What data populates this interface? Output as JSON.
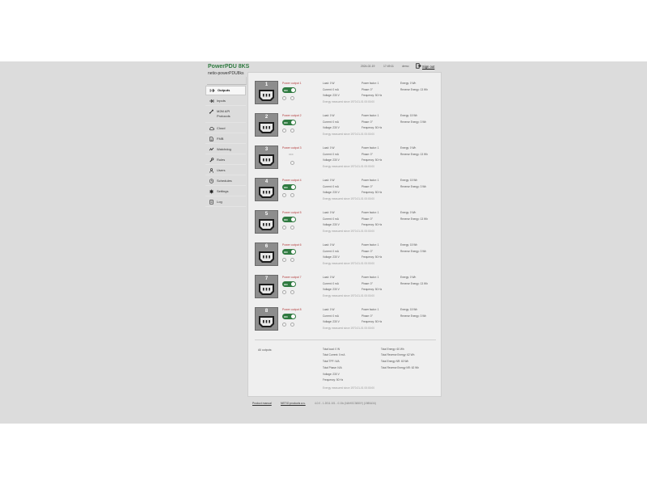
{
  "header": {
    "title": "PowerPDU 8KS",
    "device": "netio-powerPDU8ks",
    "date": "2024-02-19",
    "time": "17:49:11",
    "user": "demo",
    "sign_out": "Sign out"
  },
  "sidebar": {
    "items": [
      {
        "label": "Outputs",
        "icon": "power-out-icon",
        "active": true
      },
      {
        "label": "Inputs",
        "icon": "power-in-icon"
      },
      {
        "label": "M2M API Protocols",
        "label_line1": "M2M API",
        "label_line2": "Protocols",
        "icon": "link-icon"
      },
      {
        "label": "Cloud",
        "icon": "cloud-icon"
      },
      {
        "label": "FMB",
        "icon": "document-icon"
      },
      {
        "label": "Watchdog",
        "icon": "pulse-icon"
      },
      {
        "label": "Rules",
        "icon": "wrench-icon"
      },
      {
        "label": "Users",
        "icon": "user-icon"
      },
      {
        "label": "Schedules",
        "icon": "clock-icon"
      },
      {
        "label": "Settings",
        "icon": "gear-icon"
      },
      {
        "label": "Log",
        "icon": "log-icon"
      }
    ]
  },
  "outputs": [
    {
      "number": "1",
      "name": "Power output 1",
      "state": "ON",
      "load": "Load: 0 W",
      "current": "Current: 0 mA",
      "voltage": "Voltage: 230 V",
      "power_factor": "Power factor: 1",
      "phase": "Phase: 0°",
      "frequency": "Frequency: 50 Hz",
      "energy": "Energy: 0 Wh",
      "reverse_energy": "Reverse Energy: 13 Wh",
      "since": "Energy measured since 1970-01-01 00:00:00"
    },
    {
      "number": "2",
      "name": "Power output 2",
      "state": "ON",
      "load": "Load: 0 W",
      "current": "Current: 0 mA",
      "voltage": "Voltage: 230 V",
      "power_factor": "Power factor: 1",
      "phase": "Phase: 0°",
      "frequency": "Frequency: 50 Hz",
      "energy": "Energy: 15 Wh",
      "reverse_energy": "Reverse Energy: 3 Wh",
      "since": "Energy measured since 1970-01-01 00:00:00"
    },
    {
      "number": "3",
      "name": "Power output 3",
      "state": "OFF",
      "load": "Load: 0 W",
      "current": "Current: 0 mA",
      "voltage": "Voltage: 230 V",
      "power_factor": "Power factor: 1",
      "phase": "Phase: 0°",
      "frequency": "Frequency: 50 Hz",
      "energy": "Energy: 0 Wh",
      "reverse_energy": "Reverse Energy: 13 Wh",
      "since": "Energy measured since 1970-01-01 00:00:00"
    },
    {
      "number": "4",
      "name": "Power output 4",
      "state": "ON",
      "load": "Load: 0 W",
      "current": "Current: 0 mA",
      "voltage": "Voltage: 230 V",
      "power_factor": "Power factor: 1",
      "phase": "Phase: 0°",
      "frequency": "Frequency: 50 Hz",
      "energy": "Energy: 15 Wh",
      "reverse_energy": "Reverse Energy: 3 Wh",
      "since": "Energy measured since 1970-01-01 00:00:00"
    },
    {
      "number": "5",
      "name": "Power output 5",
      "state": "ON",
      "load": "Load: 0 W",
      "current": "Current: 0 mA",
      "voltage": "Voltage: 230 V",
      "power_factor": "Power factor: 1",
      "phase": "Phase: 0°",
      "frequency": "Frequency: 50 Hz",
      "energy": "Energy: 0 Wh",
      "reverse_energy": "Reverse Energy: 13 Wh",
      "since": "Energy measured since 1970-01-01 00:00:00"
    },
    {
      "number": "6",
      "name": "Power output 6",
      "state": "ON",
      "load": "Load: 0 W",
      "current": "Current: 0 mA",
      "voltage": "Voltage: 230 V",
      "power_factor": "Power factor: 1",
      "phase": "Phase: 0°",
      "frequency": "Frequency: 50 Hz",
      "energy": "Energy: 15 Wh",
      "reverse_energy": "Reverse Energy: 3 Wh",
      "since": "Energy measured since 1970-01-01 00:00:00"
    },
    {
      "number": "7",
      "name": "Power output 7",
      "state": "ON",
      "load": "Load: 0 W",
      "current": "Current: 0 mA",
      "voltage": "Voltage: 230 V",
      "power_factor": "Power factor: 1",
      "phase": "Phase: 0°",
      "frequency": "Frequency: 50 Hz",
      "energy": "Energy: 0 Wh",
      "reverse_energy": "Reverse Energy: 13 Wh",
      "since": "Energy measured since 1970-01-01 00:00:00"
    },
    {
      "number": "8",
      "name": "Power output 8",
      "state": "ON",
      "load": "Load: 0 W",
      "current": "Current: 0 mA",
      "voltage": "Voltage: 230 V",
      "power_factor": "Power factor: 1",
      "phase": "Phase: 0°",
      "frequency": "Frequency: 50 Hz",
      "energy": "Energy: 15 Wh",
      "reverse_energy": "Reverse Energy: 3 Wh",
      "since": "Energy measured since 1970-01-01 00:00:00"
    }
  ],
  "totals": {
    "label": "All outputs:",
    "total_load": "Total load: 0 W",
    "total_current": "Total Current: 0 mA",
    "total_tpf": "Total TPF: N/A",
    "total_phase": "Total Phase: N/A",
    "voltage": "Voltage: 230 V",
    "frequency": "Frequency: 50 Hz",
    "total_energy": "Total Energy: 60 Wh",
    "total_reverse_energy": "Total Reverse Energy: 62 Wh",
    "total_energy_nr": "Total Energy NR: 60 Wh",
    "total_reverse_energy_nr": "Total Reverse Energy NR: 62 Wh",
    "since": "Energy measured since 1970-01-01 00:00:00"
  },
  "footer": {
    "manual": "Product manual",
    "company": "NETIO products a.s.",
    "version": "4.0.0 - 1.2011.101 - 0.10c (NAHGC3650Y) (1980A34)"
  },
  "colors": {
    "accent": "#2f7a40",
    "output_name": "#b23a3a"
  }
}
